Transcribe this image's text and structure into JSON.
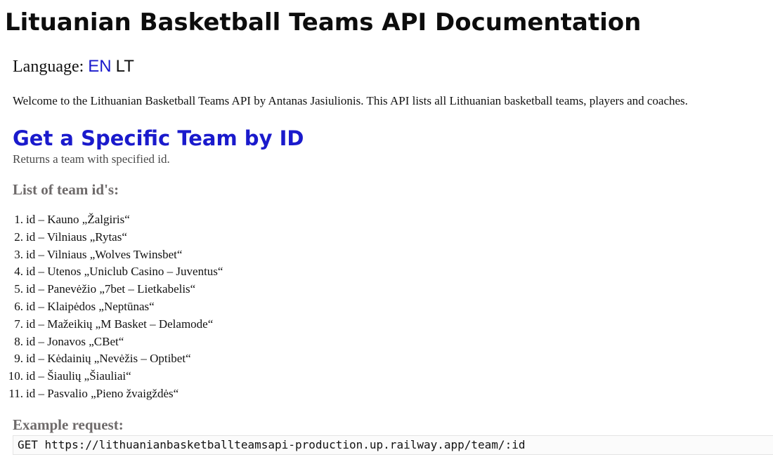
{
  "page": {
    "title": "Lituanian Basketball Teams API Documentation"
  },
  "language": {
    "label": "Language:",
    "options": [
      "EN",
      "LT"
    ],
    "active": "EN",
    "active_color": "#1a1acc"
  },
  "intro": "Welcome to the Lithuanian Basketball Teams API by Antanas Jasiulionis. This API lists all Lithuanian basketball teams, players and coaches.",
  "endpoint": {
    "title": "Get a Specific Team by ID",
    "description": "Returns a team with specified id.",
    "ids_heading": "List of team id's:",
    "teams": [
      {
        "num": "1.",
        "text": "id – Kauno „Žalgiris“"
      },
      {
        "num": "2.",
        "text": "id – Vilniaus „Rytas“"
      },
      {
        "num": "3.",
        "text": "id – Vilniaus „Wolves Twinsbet“"
      },
      {
        "num": "4.",
        "text": "id – Utenos „Uniclub Casino – Juventus“"
      },
      {
        "num": "5.",
        "text": "id – Panevėžio „7bet – Lietkabelis“"
      },
      {
        "num": "6.",
        "text": "id – Klaipėdos „Neptūnas“"
      },
      {
        "num": "7.",
        "text": "id – Mažeikių „M Basket – Delamode“"
      },
      {
        "num": "8.",
        "text": "id – Jonavos „CBet“"
      },
      {
        "num": "9.",
        "text": "id – Kėdainių „Nevėžis – Optibet“"
      },
      {
        "num": "10.",
        "text": "id – Šiaulių „Šiauliai“"
      },
      {
        "num": "11.",
        "text": "id – Pasvalio „Pieno žvaigždės“"
      }
    ],
    "example_heading": "Example request:",
    "example_request": "GET https://lithuanianbasketballteamsapi-production.up.railway.app/team/:id"
  }
}
